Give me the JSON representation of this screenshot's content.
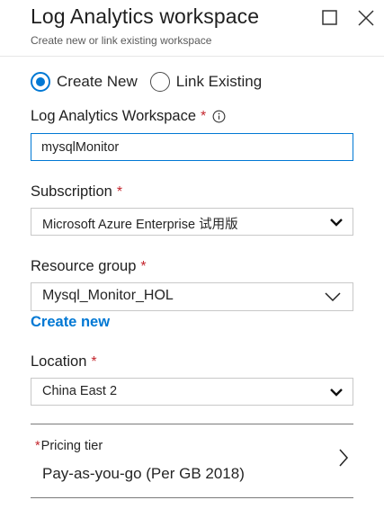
{
  "header": {
    "title": "Log Analytics workspace",
    "subtitle": "Create new or link existing workspace",
    "maximize_icon": "maximize-icon",
    "close_icon": "close-icon"
  },
  "mode": {
    "options": [
      {
        "label": "Create New",
        "selected": true
      },
      {
        "label": "Link Existing",
        "selected": false
      }
    ]
  },
  "workspace": {
    "label": "Log Analytics Workspace",
    "required_mark": "*",
    "info_icon": "info-icon",
    "value": "mysqlMonitor"
  },
  "subscription": {
    "label": "Subscription",
    "required_mark": "*",
    "value": "Microsoft Azure Enterprise 试用版",
    "icon": "chevron-down-icon"
  },
  "resource_group": {
    "label": "Resource group",
    "required_mark": "*",
    "value": "Mysql_Monitor_HOL",
    "icon": "chevron-down-icon",
    "create_new_label": "Create new"
  },
  "location": {
    "label": "Location",
    "required_mark": "*",
    "value": "China East 2",
    "icon": "chevron-down-icon"
  },
  "pricing": {
    "required_mark": "*",
    "label": "Pricing tier",
    "value": "Pay-as-you-go (Per GB 2018)",
    "icon": "chevron-right-icon"
  },
  "colors": {
    "accent": "#0078d4",
    "required": "#c4262e",
    "text": "#252525"
  }
}
